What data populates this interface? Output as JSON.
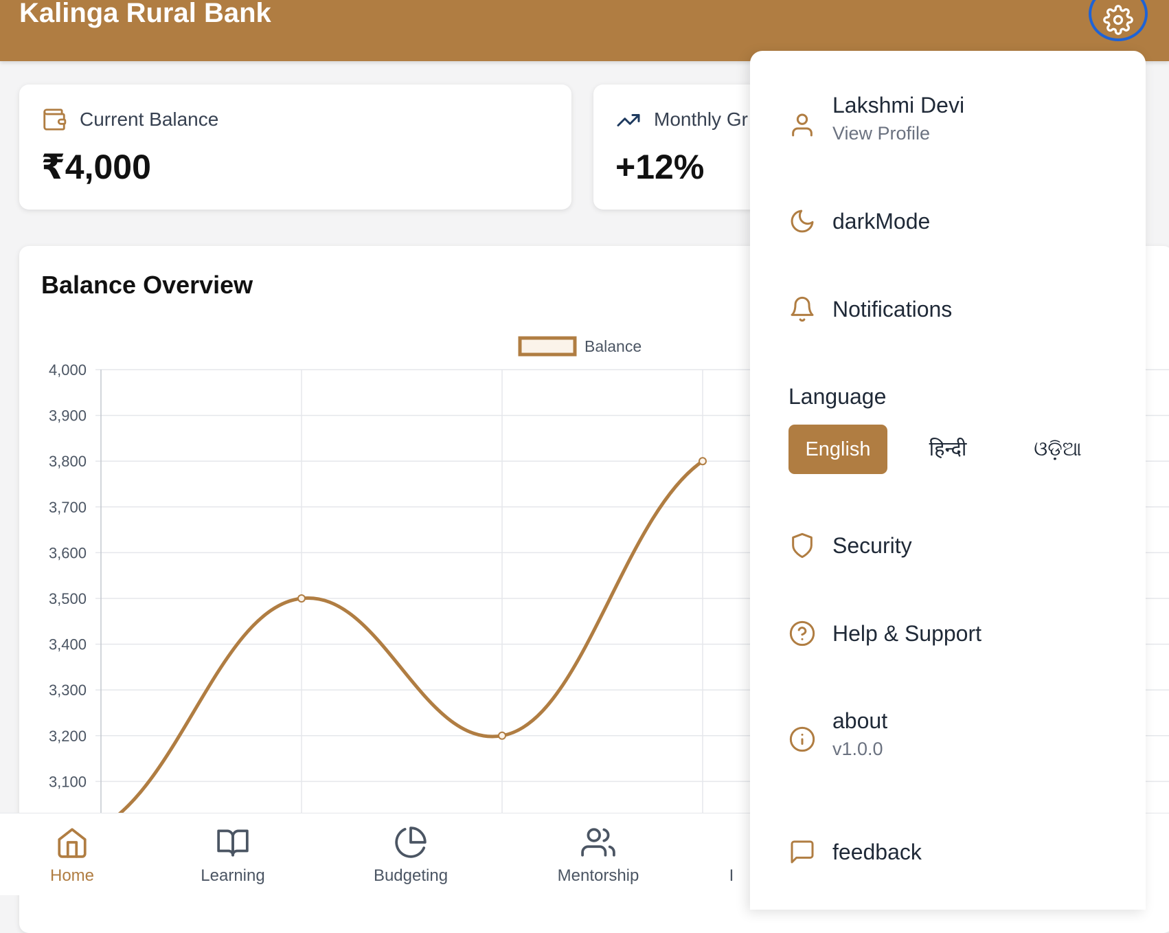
{
  "header": {
    "bank_name": "Kalinga Rural Bank"
  },
  "cards": {
    "balance": {
      "label": "Current Balance",
      "value": "₹4,000"
    },
    "growth": {
      "label": "Monthly Gr",
      "value": "+12%"
    }
  },
  "chart": {
    "title": "Balance Overview"
  },
  "chart_data": {
    "type": "line",
    "title": "Balance Overview",
    "series": [
      {
        "name": "Balance",
        "values": [
          3000,
          3500,
          3200,
          3800
        ],
        "color": "#b07d42"
      }
    ],
    "x_index": [
      0,
      1,
      2,
      3
    ],
    "ylim": [
      3100,
      4000
    ],
    "y_ticks": [
      "4,000",
      "3,900",
      "3,800",
      "3,700",
      "3,600",
      "3,500",
      "3,400",
      "3,300",
      "3,200",
      "3,100"
    ],
    "legend": "top-center",
    "grid": true
  },
  "nav": {
    "items": [
      {
        "label": "Home",
        "icon": "home-icon",
        "active": true
      },
      {
        "label": "Learning",
        "icon": "book-icon"
      },
      {
        "label": "Budgeting",
        "icon": "pie-chart-icon"
      },
      {
        "label": "Mentorship",
        "icon": "users-icon"
      },
      {
        "label": "I",
        "icon": ""
      }
    ]
  },
  "panel": {
    "profile_name": "Lakshmi Devi",
    "profile_link": "View Profile",
    "dark_mode": "darkMode",
    "notifications": "Notifications",
    "language_heading": "Language",
    "languages": [
      "English",
      "हिन्दी",
      "ଓଡ଼ିଆ"
    ],
    "selected_language": "English",
    "security": "Security",
    "help": "Help & Support",
    "about": "about",
    "version": "v1.0.0",
    "feedback": "feedback"
  },
  "colors": {
    "brand": "#b07d42",
    "focus_ring": "#1e63d6"
  }
}
